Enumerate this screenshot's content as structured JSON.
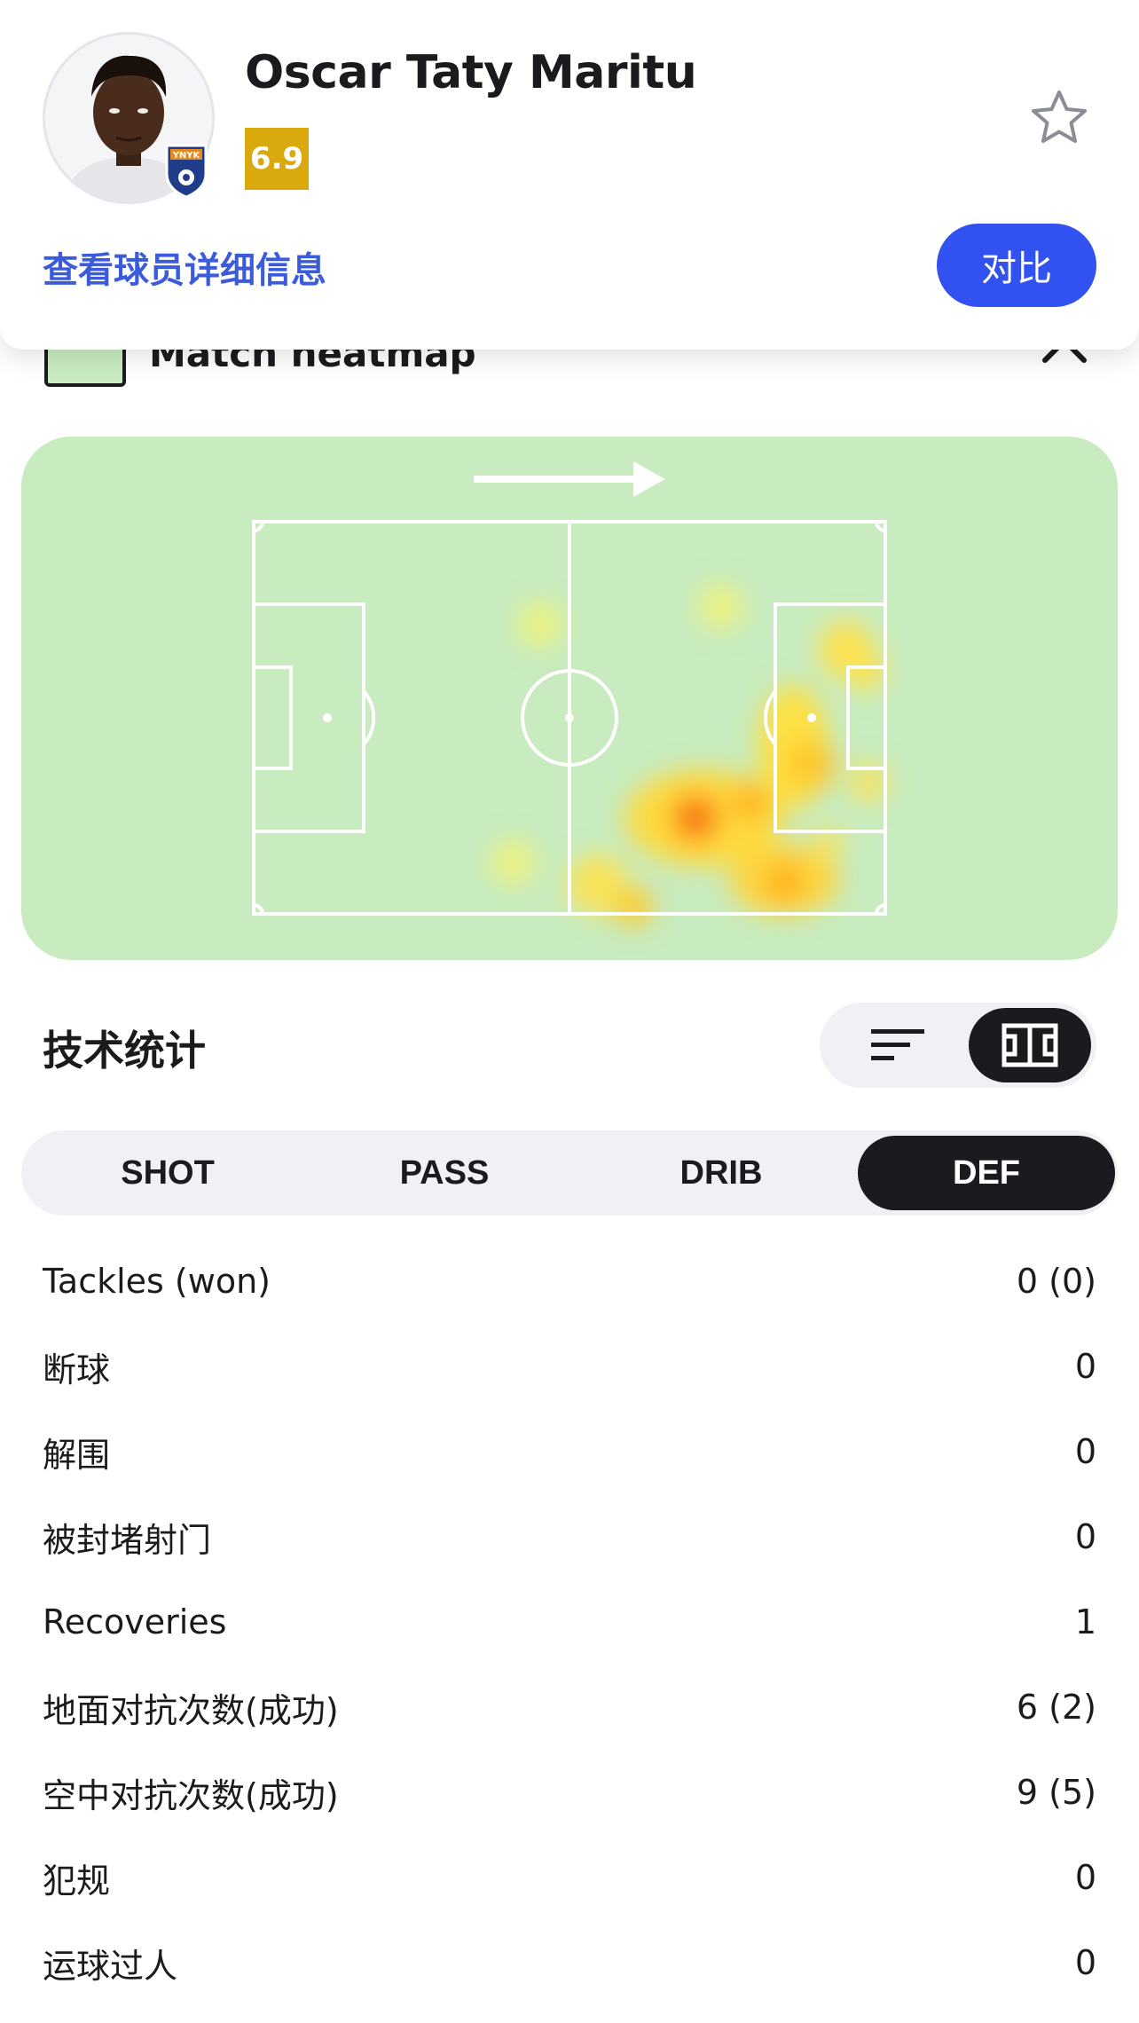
{
  "player": {
    "name": "Oscar Taty Maritu",
    "rating": "6.9",
    "rating_color": "#d9a90e",
    "team_badge_text": "YNYK",
    "details_link": "查看球员详细信息",
    "compare_label": "对比"
  },
  "heatmap": {
    "title": "Match heatmap",
    "attack_direction": "left-to-right",
    "pitch_color": "#c8ebbf"
  },
  "stats": {
    "title": "技术统计",
    "view_modes": [
      "list-icon",
      "pitch-icon"
    ],
    "active_view": "pitch-icon",
    "tabs": [
      {
        "label": "SHOT",
        "active": false
      },
      {
        "label": "PASS",
        "active": false
      },
      {
        "label": "DRIB",
        "active": false
      },
      {
        "label": "DEF",
        "active": true
      }
    ],
    "rows": [
      {
        "label": "Tackles (won)",
        "value": "0 (0)"
      },
      {
        "label": "断球",
        "value": "0"
      },
      {
        "label": "解围",
        "value": "0"
      },
      {
        "label": "被封堵射门",
        "value": "0"
      },
      {
        "label": "Recoveries",
        "value": "1"
      },
      {
        "label": "地面对抗次数(成功)",
        "value": "6 (2)"
      },
      {
        "label": "空中对抗次数(成功)",
        "value": "9 (5)"
      },
      {
        "label": "犯规",
        "value": "0"
      },
      {
        "label": "运球过人",
        "value": "0"
      }
    ]
  },
  "colors": {
    "accent_blue": "#3151f0",
    "link_blue": "#3b5bdb",
    "dark": "#1b1b1f"
  }
}
